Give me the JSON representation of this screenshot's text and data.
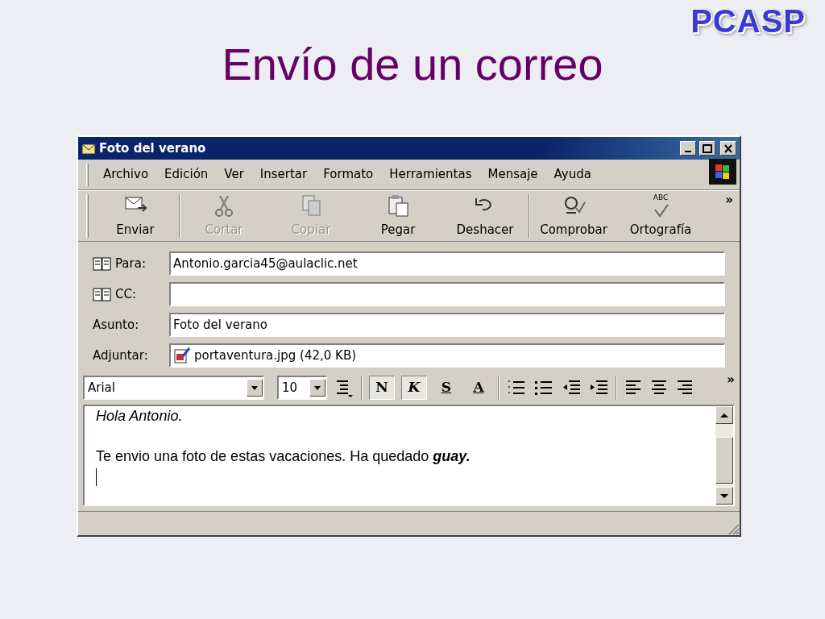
{
  "slide": {
    "title": "Envío de un correo",
    "logo": "PCASP"
  },
  "window": {
    "title": "Foto del verano"
  },
  "menu": [
    "Archivo",
    "Edición",
    "Ver",
    "Insertar",
    "Formato",
    "Herramientas",
    "Mensaje",
    "Ayuda"
  ],
  "toolbar": {
    "buttons": [
      {
        "label": "Enviar",
        "kind": "send",
        "disabled": false
      },
      {
        "label": "Cortar",
        "kind": "cut",
        "disabled": true
      },
      {
        "label": "Copiar",
        "kind": "copy",
        "disabled": true
      },
      {
        "label": "Pegar",
        "kind": "paste",
        "disabled": false
      },
      {
        "label": "Deshacer",
        "kind": "undo",
        "disabled": false
      },
      {
        "label": "Comprobar",
        "kind": "check",
        "disabled": false
      },
      {
        "label": "Ortografía",
        "kind": "spell",
        "disabled": false,
        "icon_text": "ABC"
      }
    ],
    "overflow": "»"
  },
  "fields": [
    {
      "label": "Para:",
      "kind": "address",
      "value": "Antonio.garcia45@aulaclic.net"
    },
    {
      "label": "CC:",
      "kind": "address"
    },
    {
      "label": "Asunto:",
      "kind": "text",
      "value": "Foto del verano"
    },
    {
      "label": "Adjuntar:",
      "kind": "attachment",
      "value": "portaventura.jpg (42,0 KB)"
    }
  ],
  "format_bar": {
    "font": "Arial",
    "size": "10",
    "styles": [
      {
        "label": "N",
        "kind": "bold",
        "selected": true
      },
      {
        "label": "K",
        "kind": "italic",
        "selected": true
      },
      {
        "label": "S",
        "kind": "underline",
        "selected": false
      },
      {
        "label": "A",
        "kind": "color",
        "selected": false
      }
    ],
    "overflow": "»"
  },
  "body": [
    {
      "kind": "italic",
      "text": "Hola Antonio."
    },
    {
      "kind": "blank"
    },
    {
      "kind": "plain",
      "text": "Te envio una foto de estas vacaciones. Ha quedado **guay.**"
    },
    {
      "kind": "cursor"
    }
  ]
}
